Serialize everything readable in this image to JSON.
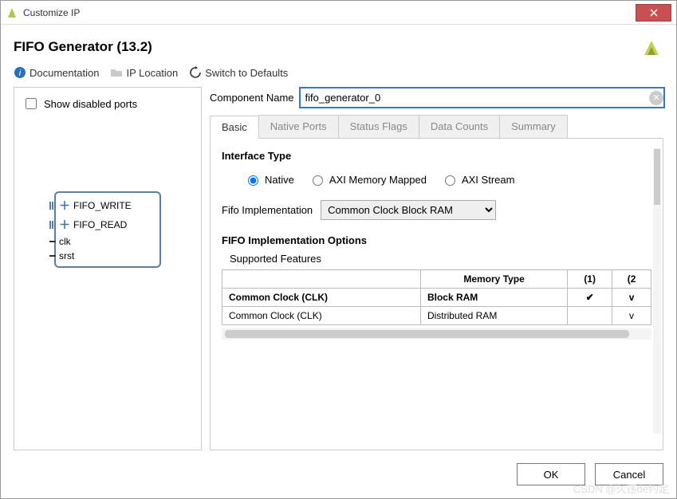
{
  "window": {
    "title": "Customize IP"
  },
  "header": {
    "title": "FIFO Generator (13.2)"
  },
  "toolbar": {
    "documentation": "Documentation",
    "ip_location": "IP Location",
    "switch_defaults": "Switch to Defaults"
  },
  "left": {
    "show_disabled": "Show disabled ports",
    "ports": [
      "FIFO_WRITE",
      "FIFO_READ",
      "clk",
      "srst"
    ]
  },
  "component": {
    "label": "Component Name",
    "value": "fifo_generator_0"
  },
  "tabs": [
    "Basic",
    "Native Ports",
    "Status Flags",
    "Data Counts",
    "Summary"
  ],
  "basic": {
    "interface_type": "Interface Type",
    "radios": [
      "Native",
      "AXI Memory Mapped",
      "AXI Stream"
    ],
    "fifo_impl_label": "Fifo Implementation",
    "fifo_impl_value": "Common Clock Block RAM",
    "options_title": "FIFO Implementation Options",
    "supported_features": "Supported Features",
    "table": {
      "headers": [
        "",
        "Memory Type",
        "(1)",
        "(2"
      ],
      "rows": [
        {
          "name": "Common Clock (CLK)",
          "mem": "Block RAM",
          "c1": "✔",
          "c2": "v",
          "bold": true
        },
        {
          "name": "Common Clock (CLK)",
          "mem": "Distributed RAM",
          "c1": "",
          "c2": "v",
          "bold": false
        }
      ]
    }
  },
  "footer": {
    "ok": "OK",
    "cancel": "Cancel"
  },
  "watermark": "CSDN @久违de约定"
}
